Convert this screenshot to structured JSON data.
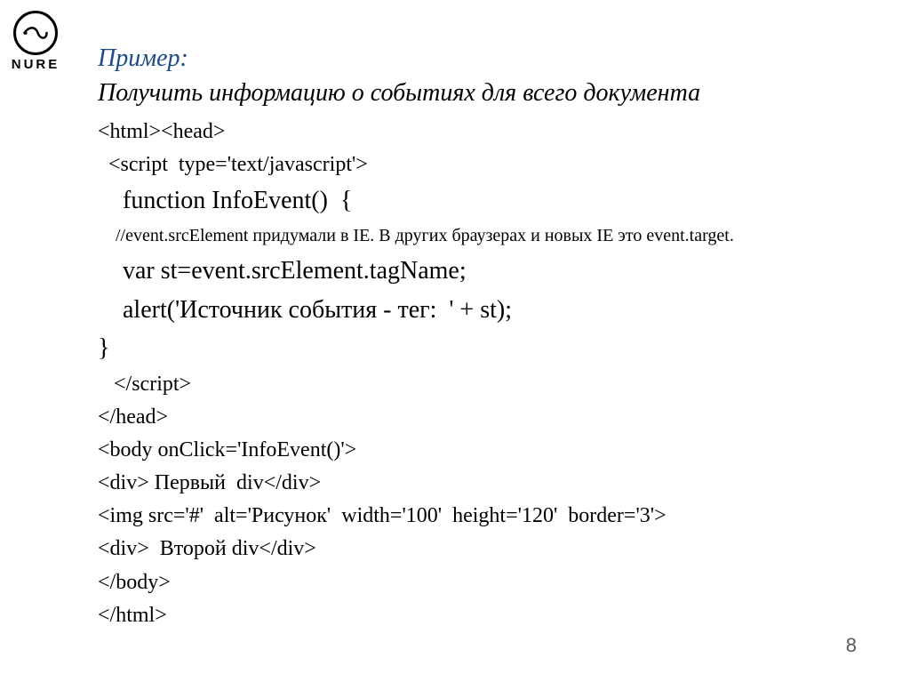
{
  "logo": {
    "text": "NURE"
  },
  "title": "Пример:",
  "subtitle": "Получить информацию о событиях для всего документа",
  "code": {
    "l1": "<html><head>",
    "l2": "  <script  type='text/javascript'>",
    "l3": "    function InfoEvent()  {",
    "l4": "    //event.srcElement придумали в IE. В других браузерах и новых IE это event.target.",
    "l5": "    var st=event.srcElement.tagName;",
    "l6": "    alert('Источник события - тег:  ' + st);",
    "l7": "}",
    "l8": "   </script>",
    "l9": "</head>",
    "l10": "<body onClick='InfoEvent()'>",
    "l11": "<div> Первый  div</div>",
    "l12": "<img src='#'  alt='Рисунок'  width='100'  height='120'  border='3'>",
    "l13": "<div>  Второй div</div>",
    "l14": "</body>",
    "l15": "</html>"
  },
  "page_number": "8"
}
